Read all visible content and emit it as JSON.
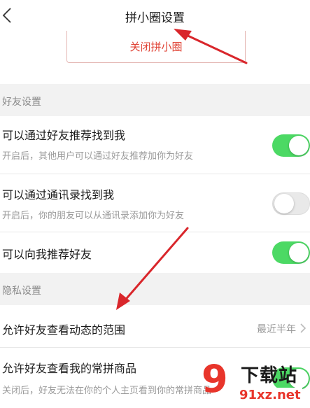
{
  "header": {
    "title": "拼小圈设置"
  },
  "close_button_label": "关闭拼小圈",
  "sections": {
    "friends": {
      "title": "好友设置",
      "items": [
        {
          "title": "可以通过好友推荐找到我",
          "desc": "开启后，其他用户可以通过好友推荐加你为好友",
          "toggle": true
        },
        {
          "title": "可以通过通讯录找到我",
          "desc": "开启后，你的朋友可以从通讯录添加你为好友",
          "toggle": false
        },
        {
          "title": "可以向我推荐好友",
          "toggle": true
        }
      ]
    },
    "privacy": {
      "title": "隐私设置",
      "items": [
        {
          "title": "允许好友查看动态的范围",
          "value": "最近半年"
        },
        {
          "title": "允许好友查看我的常拼商品",
          "desc": "关闭后，好友无法在你的个人主页看到你的常拼商品",
          "toggle": true
        }
      ]
    }
  },
  "watermark": {
    "mark": "9",
    "text": "下载站",
    "url": "91xz.net"
  },
  "colors": {
    "accent_red": "#e04436",
    "toggle_on": "#4cd964",
    "annotation_arrow": "#d9262b"
  }
}
